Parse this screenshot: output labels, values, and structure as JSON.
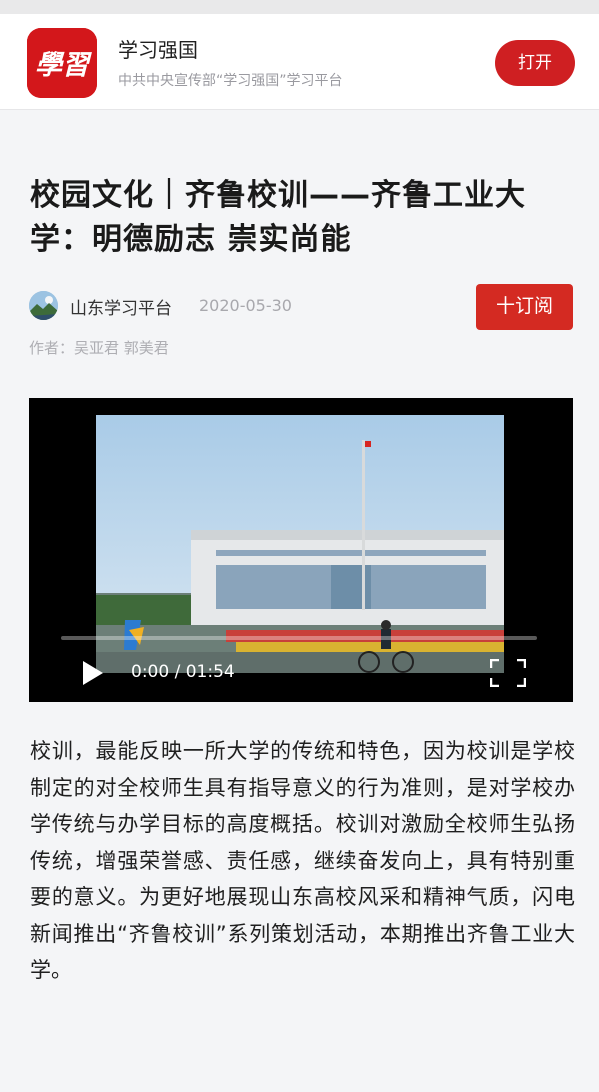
{
  "app_bar": {
    "logo_text": "學習",
    "app_name": "学习强国",
    "app_description": "中共中央宣传部“学习强国”学习平台",
    "open_label": "打开"
  },
  "article": {
    "title": "校园文化｜齐鲁校训——齐鲁工业大学：明德励志 崇实尚能",
    "source_name": "山东学习平台",
    "publish_date": "2020-05-30",
    "subscribe_label": "十订阅",
    "author_line": "作者：吴亚君 郭美君",
    "video": {
      "current_time": "0:00",
      "duration": "01:54",
      "time_display": "0:00 / 01:54",
      "progress": 0
    },
    "body": "校训，最能反映一所大学的传统和特色，因为校训是学校制定的对全校师生具有指导意义的行为准则，是对学校办学传统与办学目标的高度概括。校训对激励全校师生弘扬传统，增强荣誉感、责任感，继续奋发向上，具有特别重要的意义。为更好地展现山东高校风采和精神气质，闪电新闻推出“齐鲁校训”系列策划活动，本期推出齐鲁工业大学。"
  },
  "colors": {
    "brand_red": "#cf1f22",
    "subscribe_red": "#d42a22",
    "page_background": "#f4f5f7"
  },
  "icons": {
    "logo": "xuexi-logo-icon",
    "avatar": "source-avatar-icon",
    "play": "play-icon",
    "fullscreen": "fullscreen-icon"
  }
}
